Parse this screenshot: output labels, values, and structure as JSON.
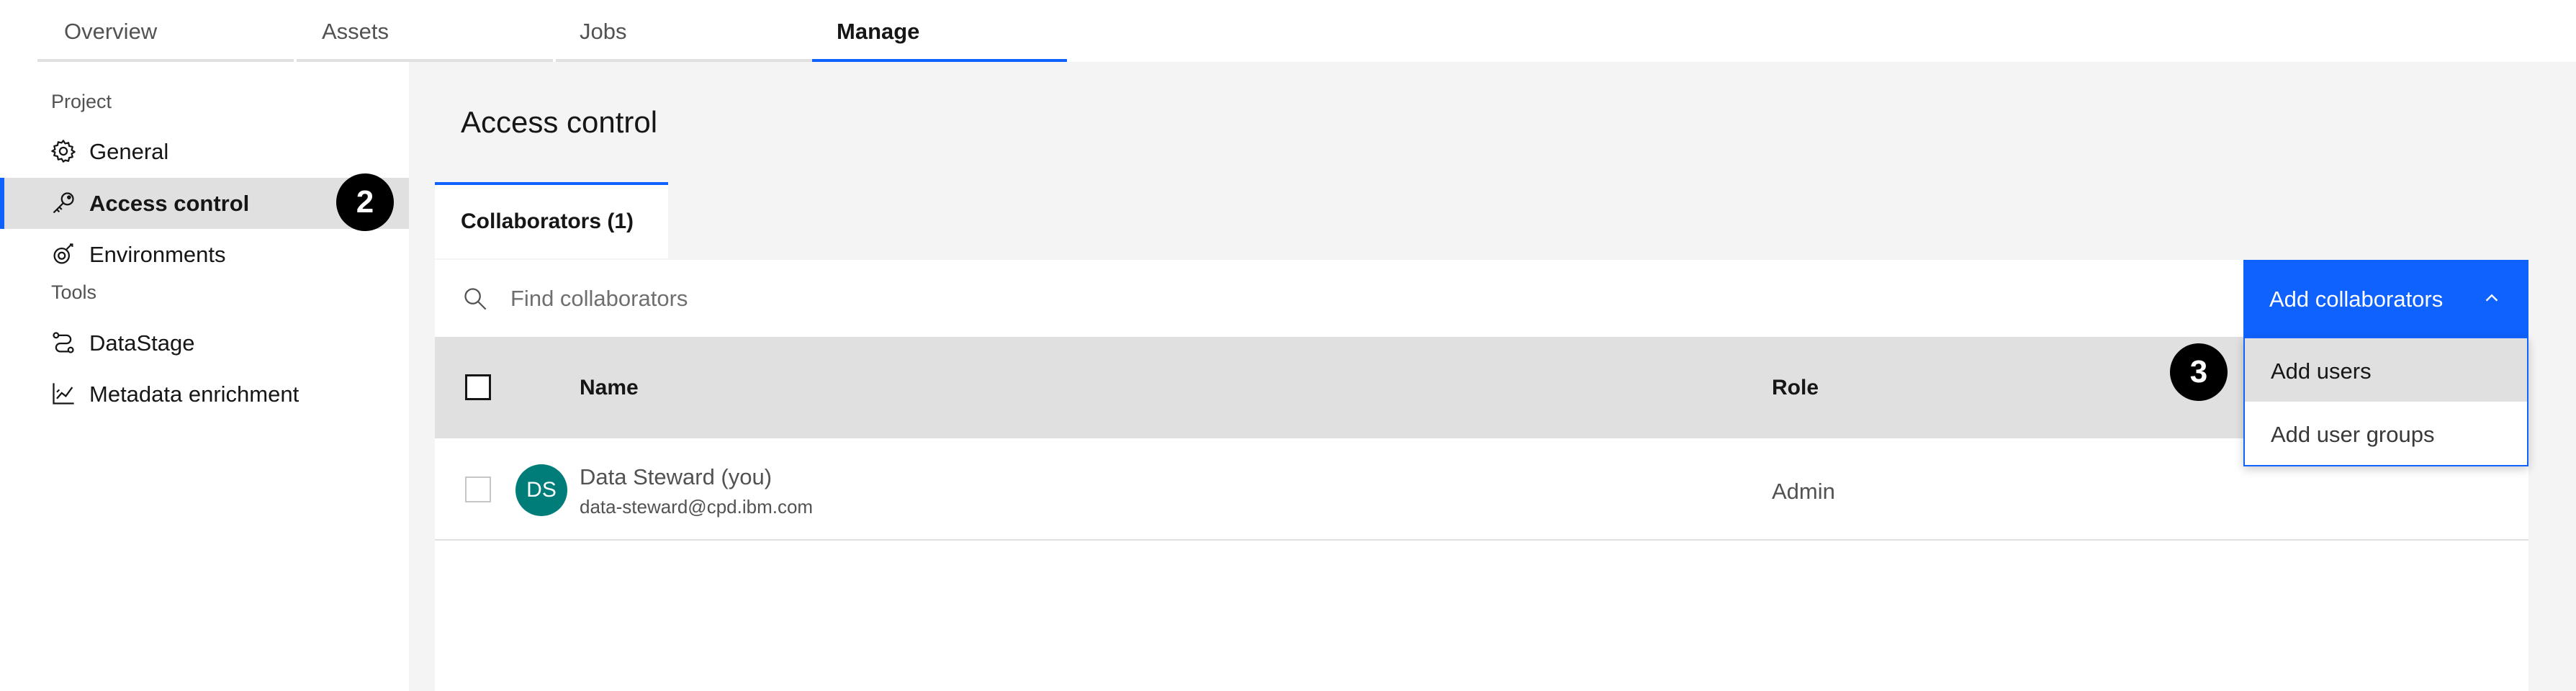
{
  "top_tabs": [
    {
      "label": "Overview"
    },
    {
      "label": "Assets"
    },
    {
      "label": "Jobs"
    },
    {
      "label": "Manage",
      "active": true
    }
  ],
  "sidebar": {
    "sections": [
      {
        "title": "Project"
      },
      {
        "title": "Tools"
      }
    ],
    "items": [
      {
        "label": "General",
        "icon": "gear-icon"
      },
      {
        "label": "Access control",
        "icon": "key-icon",
        "active": true
      },
      {
        "label": "Environments",
        "icon": "environments-icon"
      },
      {
        "label": "DataStage",
        "icon": "datastage-icon"
      },
      {
        "label": "Metadata enrichment",
        "icon": "chart-line-icon"
      }
    ]
  },
  "callouts": {
    "step2": "2",
    "step3": "3"
  },
  "main": {
    "title": "Access control",
    "tab_label": "Collaborators (1)",
    "search_placeholder": "Find collaborators",
    "add_button_label": "Add collaborators",
    "table": {
      "columns": [
        "Name",
        "Role"
      ],
      "rows": [
        {
          "initials": "DS",
          "name": "Data Steward (you)",
          "email": "data-steward@cpd.ibm.com",
          "role": "Admin"
        }
      ]
    },
    "dropdown": [
      "Add users",
      "Add user groups"
    ]
  },
  "colors": {
    "accent": "#0f62fe",
    "avatar": "#007d79",
    "header_bg": "#e0e0e0",
    "page_bg": "#f4f4f4"
  }
}
